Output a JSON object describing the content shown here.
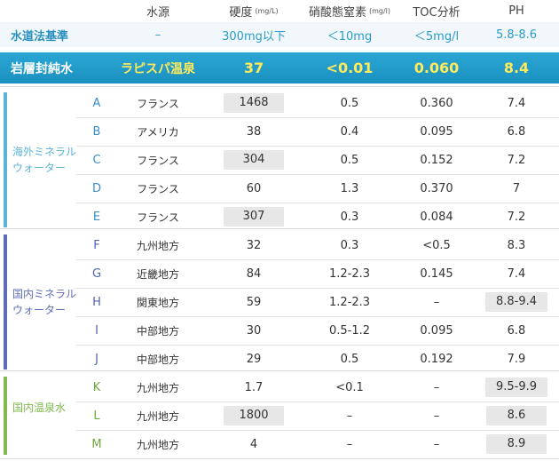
{
  "header": {
    "source": "水源",
    "hardness": "硬度",
    "hardness_unit": "(mg/L)",
    "nitrate": "硝酸態窒素",
    "nitrate_unit": "(mg/l)",
    "toc": "TOC分析",
    "ph": "PH"
  },
  "standard": {
    "label": "水道法基準",
    "source": "–",
    "hardness": "300mg以下",
    "nitrate": "＜10mg",
    "toc": "＜5mg/l",
    "ph": "5.8-8.6"
  },
  "featured": {
    "label": "岩層封純水",
    "source": "ラピスパ温泉",
    "hardness": "37",
    "nitrate": "<0.01",
    "toc": "0.060",
    "ph": "8.4"
  },
  "groups": [
    {
      "title": "海外ミネラルウォーター",
      "color": "#5ab4d8",
      "rows": [
        {
          "code": "A",
          "source": "フランス",
          "hardness": "1468",
          "nitrate": "0.5",
          "toc": "0.360",
          "ph": "7.4",
          "hl_hardness": true,
          "hl_ph": false
        },
        {
          "code": "B",
          "source": "アメリカ",
          "hardness": "38",
          "nitrate": "0.4",
          "toc": "0.095",
          "ph": "6.8",
          "hl_hardness": false,
          "hl_ph": false
        },
        {
          "code": "C",
          "source": "フランス",
          "hardness": "304",
          "nitrate": "0.5",
          "toc": "0.152",
          "ph": "7.2",
          "hl_hardness": true,
          "hl_ph": false
        },
        {
          "code": "D",
          "source": "フランス",
          "hardness": "60",
          "nitrate": "1.3",
          "toc": "0.370",
          "ph": "7",
          "hl_hardness": false,
          "hl_ph": false
        },
        {
          "code": "E",
          "source": "フランス",
          "hardness": "307",
          "nitrate": "0.3",
          "toc": "0.084",
          "ph": "7.2",
          "hl_hardness": true,
          "hl_ph": false
        }
      ]
    },
    {
      "title": "国内ミネラルウォーター",
      "color": "#5d6dbb",
      "rows": [
        {
          "code": "F",
          "source": "九州地方",
          "hardness": "32",
          "nitrate": "0.3",
          "toc": "<0.5",
          "ph": "8.3",
          "hl_hardness": false,
          "hl_ph": false
        },
        {
          "code": "G",
          "source": "近畿地方",
          "hardness": "84",
          "nitrate": "1.2-2.3",
          "toc": "0.145",
          "ph": "7.4",
          "hl_hardness": false,
          "hl_ph": false
        },
        {
          "code": "H",
          "source": "関東地方",
          "hardness": "59",
          "nitrate": "1.2-2.3",
          "toc": "–",
          "ph": "8.8-9.4",
          "hl_hardness": false,
          "hl_ph": true
        },
        {
          "code": "I",
          "source": "中部地方",
          "hardness": "30",
          "nitrate": "0.5-1.2",
          "toc": "0.095",
          "ph": "6.8",
          "hl_hardness": false,
          "hl_ph": false
        },
        {
          "code": "J",
          "source": "中部地方",
          "hardness": "29",
          "nitrate": "0.5",
          "toc": "0.192",
          "ph": "7.9",
          "hl_hardness": false,
          "hl_ph": false
        }
      ]
    },
    {
      "title": "国内温泉水",
      "color": "#7fba4a",
      "rows": [
        {
          "code": "K",
          "source": "九州地方",
          "hardness": "1.7",
          "nitrate": "<0.1",
          "toc": "–",
          "ph": "9.5-9.9",
          "hl_hardness": false,
          "hl_ph": true
        },
        {
          "code": "L",
          "source": "九州地方",
          "hardness": "1800",
          "nitrate": "–",
          "toc": "–",
          "ph": "8.6",
          "hl_hardness": true,
          "hl_ph": true
        },
        {
          "code": "M",
          "source": "九州地方",
          "hardness": "4",
          "nitrate": "–",
          "toc": "–",
          "ph": "8.9",
          "hl_hardness": false,
          "hl_ph": true
        }
      ]
    }
  ]
}
